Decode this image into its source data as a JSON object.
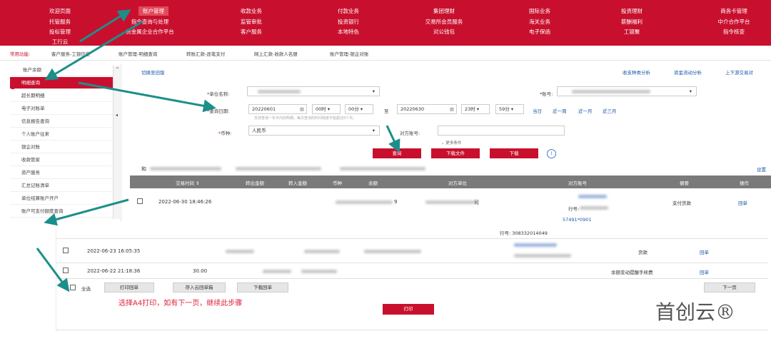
{
  "topnav": {
    "col1": [
      "欢迎页面",
      "托管服务",
      "投标管理",
      "工行云"
    ],
    "col2": [
      "账户管理",
      "指令查询与处理",
      "资金属企业合作平台"
    ],
    "col3": [
      "收款业务",
      "监管审批",
      "客户服务"
    ],
    "col4": [
      "付款业务",
      "投资银行",
      "本地特色"
    ],
    "col5": [
      "集团理财",
      "交易所会员服务",
      "对公钱包"
    ],
    "col6": [
      "国际业务",
      "海关业务",
      "电子保函"
    ],
    "col7": [
      "投资理财",
      "薪酬福利",
      "工银聚"
    ],
    "col8": [
      "商务卡管理",
      "中介合作平台",
      "指令核查"
    ]
  },
  "quickbar": {
    "title": "常用功能:",
    "items": [
      "客户服务-工银信使",
      "账户管理-明细查询",
      "转账汇款-逐笔支付",
      "网上汇款-收款人名册",
      "账户管理-银企对账"
    ]
  },
  "sidebar": {
    "header": "账户余额",
    "items": [
      "明细查询",
      "超长期明细",
      "电子对账单",
      "信息报告查询",
      "个人账户往来",
      "银企对账",
      "收款管家",
      "资产服务",
      "汇总记账清单",
      "单位结算账户开户",
      "账户可支付额度查询"
    ]
  },
  "main": {
    "switch_link": "切换至旧版",
    "top_links": [
      "收支种类分析",
      "资金流动分析",
      "上下游交易对"
    ],
    "unit_label": "单位名称:",
    "account_label": "*账号:",
    "date_label": "查询日期:",
    "start_date": "20220601",
    "start_hour": "00时",
    "start_min": "00分",
    "to": "至",
    "end_date": "20220630",
    "end_hour": "23时",
    "end_min": "59分",
    "quick_dates": [
      "当日",
      "近一周",
      "近一月",
      "近三月"
    ],
    "date_hint": "支持查询一年半内的明细，每次查询的时间跨度不能超过6个月。",
    "currency_label": "币种:",
    "currency_value": "人民币",
    "counterparty_label": "对方账号:",
    "more": "更多条件",
    "btn_query": "查询",
    "btn_download_file": "下载文件",
    "btn_download": "下载",
    "settings": "设置"
  },
  "table": {
    "headers": [
      "交易时间",
      "转出金额",
      "转入金额",
      "币种",
      "余额",
      "对方单位",
      "对方账号",
      "摘要",
      "操作"
    ],
    "row1": {
      "time": "2022-06-30  18:46:26",
      "balance_tail": "9",
      "unit_tail": "司",
      "bank_label": "行号:",
      "summary": "支付货款",
      "action": "回单",
      "next_acct": "57491*0901"
    },
    "row_partial_bank": "行号: 308332014049",
    "row2": {
      "time": "2022-06-23  16:05:35",
      "summary": "货款",
      "action": "回单"
    },
    "row3": {
      "time": "2022-06-22  21:18:36",
      "amount": "30.00",
      "summary": "余额变动提醒手续费",
      "action": "回单"
    }
  },
  "footer": {
    "select_all": "全选",
    "btn_print_receipt": "打印回单",
    "btn_save_cloud": "存入云回单箱",
    "btn_download_receipt": "下载回单",
    "btn_next_page": "下一页",
    "instruction": "选择A4打印，如有下一页，继续此步骤",
    "btn_print": "打印"
  },
  "watermark": "首创云®",
  "colors": {
    "brand_red": "#c8102e",
    "arrow_teal": "#1b8f8a",
    "header_gray": "#7a7a7a"
  }
}
